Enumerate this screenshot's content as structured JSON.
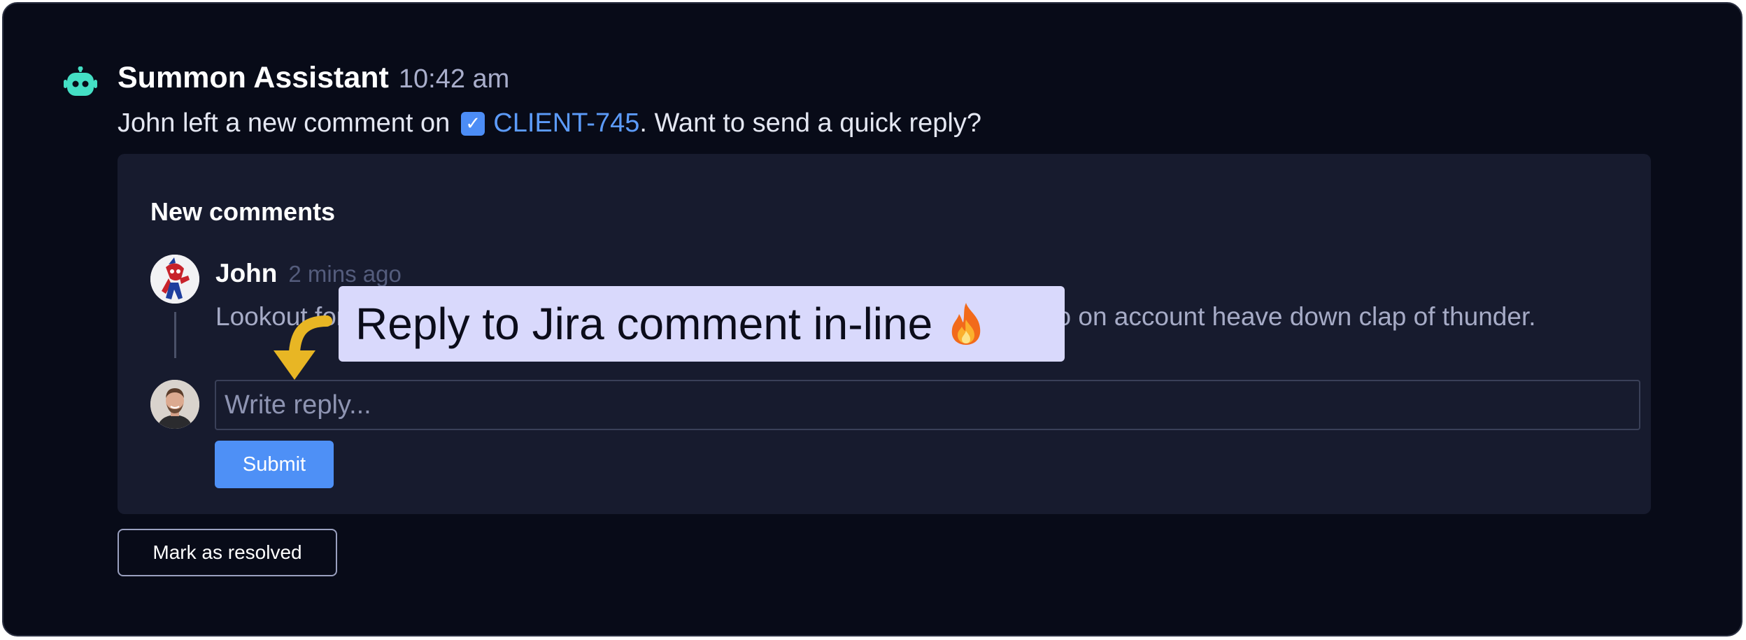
{
  "header": {
    "app_name": "Summon Assistant",
    "timestamp": "10:42 am"
  },
  "message": {
    "prefix": "John left a new comment on",
    "ticket_id": "CLIENT-745",
    "suffix": ". Want to send a quick reply?"
  },
  "card": {
    "title": "New comments",
    "comment": {
      "author": "John",
      "time": "2 mins ago",
      "body": "Lookout fore gaff hulk crimp grog Pieces of Eight avast aft chantey grog go on account heave down clap of thunder."
    },
    "reply": {
      "placeholder": "Write reply...",
      "value": ""
    },
    "submit_label": "Submit"
  },
  "resolve_label": "Mark as resolved",
  "callout": {
    "text": "Reply to Jira comment in-line"
  },
  "icons": {
    "bot": "robot-icon",
    "ticket": "checkbox-icon",
    "fire": "fire-icon",
    "arrow": "curved-arrow-icon"
  },
  "colors": {
    "background": "#080b18",
    "card": "#171b2e",
    "bot_accent": "#44dfc4",
    "link": "#5c9bfa",
    "button_primary": "#4e90f6",
    "callout_bg": "#d9d9fc",
    "arrow": "#e8b624"
  }
}
